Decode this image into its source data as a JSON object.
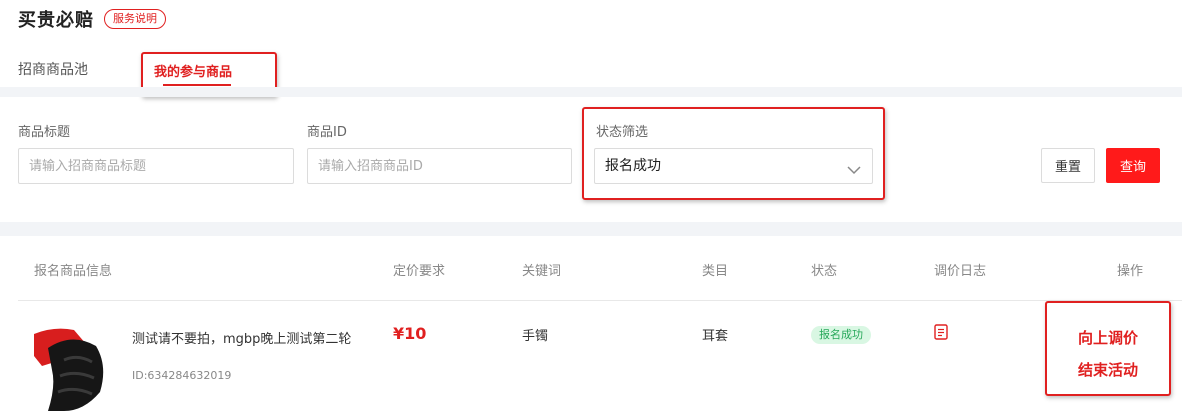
{
  "header": {
    "title": "买贵必赔",
    "service_badge": "服务说明"
  },
  "tabs": {
    "pool": "招商商品池",
    "mine": "我的参与商品"
  },
  "filters": {
    "title_label": "商品标题",
    "title_placeholder": "请输入招商商品标题",
    "id_label": "商品ID",
    "id_placeholder": "请输入招商商品ID",
    "status_label": "状态筛选",
    "status_value": "报名成功",
    "reset_label": "重置",
    "query_label": "查询"
  },
  "table": {
    "headers": {
      "product_info": "报名商品信息",
      "price_req": "定价要求",
      "keyword": "关键词",
      "category": "类目",
      "status": "状态",
      "price_log": "调价日志",
      "action": "操作"
    },
    "rows": [
      {
        "title": "测试请不要拍，mgbp晚上测试第二轮",
        "id": "ID:634284632019",
        "price": "¥10",
        "keyword": "手镯",
        "category": "耳套",
        "status": "报名成功",
        "actions": {
          "raise_price": "向上调价",
          "end_activity": "结束活动"
        }
      }
    ]
  },
  "colors": {
    "accent": "#e02020",
    "query_button": "#ff1a1a",
    "status_bg": "#d9f7e3",
    "status_text": "#27a85a"
  },
  "icons": {
    "chevron": "chevron-down-icon",
    "log": "document-icon"
  }
}
